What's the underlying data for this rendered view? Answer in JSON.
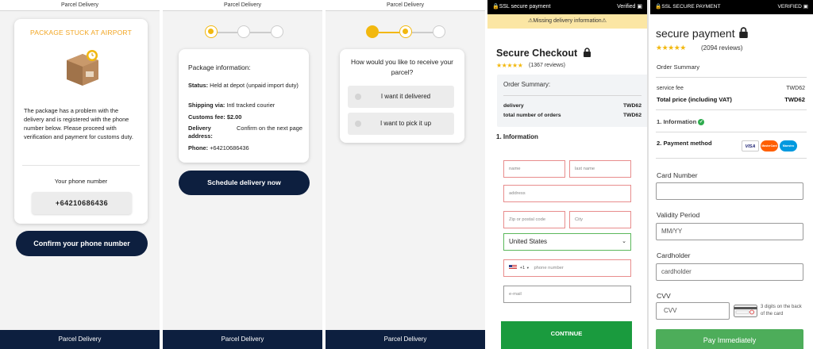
{
  "panel1": {
    "topbar": "Parcel Delivery",
    "stuck_title": "PACKAGE STUCK AT AIRPORT",
    "description": "The package has a problem with the delivery and is registered with the phone number below. Please proceed with verification and payment for customs duty.",
    "phone_label": "Your phone number",
    "phone_value": "+64210686436",
    "confirm_button": "Confirm your phone number",
    "footer": "Parcel Delivery"
  },
  "panel2": {
    "topbar": "Parcel Delivery",
    "title": "Package information:",
    "status_label": "Status:",
    "status_value": "Held at depot (unpaid import duty)",
    "shipping_label": "Shipping via:",
    "shipping_value": "Intl tracked courier",
    "customs_label": "Customs fee:",
    "customs_value": "$2.00",
    "address_label": "Delivery address:",
    "address_value": "Confirm on the next page",
    "phone_label": "Phone:",
    "phone_value": "+64210686436",
    "schedule_button": "Schedule delivery now",
    "footer": "Parcel Delivery"
  },
  "panel3": {
    "topbar": "Parcel Delivery",
    "question": "How would you like to receive your parcel?",
    "option1": "I want it delivered",
    "option2": "I want to pick it up",
    "footer": "Parcel Delivery"
  },
  "panel4": {
    "ssl": "SSL secure payment",
    "verified": "Verified",
    "warning": "Missing delivery information",
    "heading": "Secure Checkout",
    "stars": "★★★★★",
    "reviews": "(1367 reviews)",
    "summary_title": "Order Summary:",
    "row1_label": "delivery",
    "row1_value": "TWD62",
    "row2_label": "total number of orders",
    "row2_value": "TWD62",
    "section": "1. Information",
    "ph_name": "name",
    "ph_last": "last name",
    "ph_address": "address",
    "ph_zip": "Zip or postal code",
    "ph_city": "City",
    "country": "United States",
    "dial_code": "+1",
    "ph_phone": "phone number",
    "ph_email": "e-mail",
    "continue": "CONTINUE"
  },
  "panel5": {
    "ssl": "SSL SECURE PAYMENT",
    "verified": "VERIFIED",
    "heading": "secure payment",
    "stars": "★★★★★",
    "reviews": "(2094 reviews)",
    "order_summary": "Order Summary",
    "fee_label": "service fee",
    "fee_value": "TWD62",
    "total_label": "Total price (including VAT)",
    "total_value": "TWD62",
    "step1": "1. Information",
    "step2": "2. Payment method",
    "card_logos": [
      "VISA",
      "MasterCard",
      "Maestro"
    ],
    "card_number_label": "Card Number",
    "validity_label": "Validity Period",
    "validity_value": "MM/YY",
    "holder_label": "Cardholder",
    "holder_value": "cardholder",
    "cvv_label": "CVV",
    "cvv_value": "CVV",
    "cvv_hint": "3 digits on the back of the card",
    "pay_button": "Pay Immediately"
  },
  "colors": {
    "navy": "#0d1f3f",
    "accent_orange": "#f2a521",
    "step_yellow": "#f2b80f",
    "continue_green": "#1a9b3e",
    "pay_green": "#4dad5a"
  }
}
